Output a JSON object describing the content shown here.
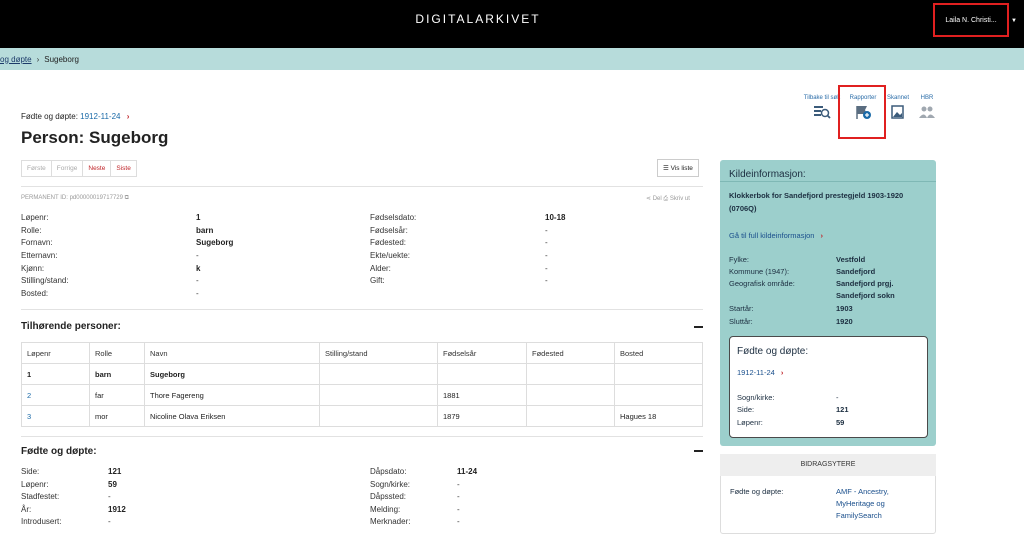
{
  "header": {
    "brand": "DIGITALARKIVET",
    "user": "Laila N. Christi..."
  },
  "breadcrumb": {
    "parent": "og døpte",
    "current": "Sugeborg"
  },
  "subcrumb": {
    "label": "Fødte og døpte:",
    "date": "1912-11-24"
  },
  "title": "Person: Sugeborg",
  "pager": {
    "first": "Første",
    "prev": "Forrige",
    "next": "Neste",
    "last": "Siste"
  },
  "vis_liste": "Vis liste",
  "permanent_id": "PERMANENT ID: pd00000019717729",
  "share": {
    "del": "Del",
    "print": "Skriv ut"
  },
  "person": {
    "left": [
      {
        "k": "Løpenr:",
        "v": "1"
      },
      {
        "k": "Rolle:",
        "v": "barn"
      },
      {
        "k": "Fornavn:",
        "v": "Sugeborg"
      },
      {
        "k": "Etternavn:",
        "v": "-"
      },
      {
        "k": "Kjønn:",
        "v": "k"
      },
      {
        "k": "Stilling/stand:",
        "v": "-"
      },
      {
        "k": "Bosted:",
        "v": "-"
      }
    ],
    "right": [
      {
        "k": "Fødselsdato:",
        "v": "10-18"
      },
      {
        "k": "Fødselsår:",
        "v": "-"
      },
      {
        "k": "Fødested:",
        "v": "-"
      },
      {
        "k": "Ekte/uekte:",
        "v": "-"
      },
      {
        "k": "Alder:",
        "v": "-"
      },
      {
        "k": "Gift:",
        "v": "-"
      }
    ]
  },
  "related": {
    "title": "Tilhørende personer:",
    "headers": [
      "Løpenr",
      "Rolle",
      "Navn",
      "Stilling/stand",
      "Fødselsår",
      "Fødested",
      "Bosted"
    ],
    "rows": [
      [
        "1",
        "barn",
        "Sugeborg",
        "",
        "",
        "",
        ""
      ],
      [
        "2",
        "far",
        "Thore Fagereng",
        "",
        "1881",
        "",
        ""
      ],
      [
        "3",
        "mor",
        "Nicoline Olava Eriksen",
        "",
        "1879",
        "",
        "Hagues 18"
      ]
    ]
  },
  "fodte": {
    "title": "Fødte og døpte:",
    "left": [
      {
        "k": "Side:",
        "v": "121"
      },
      {
        "k": "Løpenr:",
        "v": "59"
      },
      {
        "k": "Stadfestet:",
        "v": "-"
      },
      {
        "k": "År:",
        "v": "1912"
      },
      {
        "k": "Introdusert:",
        "v": "-"
      }
    ],
    "right": [
      {
        "k": "Dåpsdato:",
        "v": "11-24"
      },
      {
        "k": "Sogn/kirke:",
        "v": "-"
      },
      {
        "k": "Dåpssted:",
        "v": "-"
      },
      {
        "k": "Melding:",
        "v": "-"
      },
      {
        "k": "Merknader:",
        "v": "-"
      }
    ]
  },
  "toolbar": {
    "back": "Tilbake til søk",
    "reports": "Rapporter",
    "scanned": "Skannet",
    "hbr": "HBR"
  },
  "kilde": {
    "title": "Kildeinformasjon:",
    "source": "Klokkerbok for Sandefjord prestegjeld 1903-1920 (0706Q)",
    "link": "Gå til full kildeinformasjon",
    "rows": [
      {
        "k": "Fylke:",
        "v": "Vestfold"
      },
      {
        "k": "Kommune (1947):",
        "v": "Sandefjord"
      },
      {
        "k": "Geografisk område:",
        "v": "Sandefjord prgj."
      },
      {
        "k": "",
        "v": "Sandefjord sokn"
      },
      {
        "k": "Startår:",
        "v": "1903"
      },
      {
        "k": "Sluttår:",
        "v": "1920"
      }
    ],
    "inner": {
      "title": "Fødte og døpte:",
      "date": "1912-11-24",
      "rows": [
        {
          "k": "Sogn/kirke:",
          "v": "-"
        },
        {
          "k": "Side:",
          "v": "121"
        },
        {
          "k": "Løpenr:",
          "v": "59"
        }
      ]
    }
  },
  "bidrag": {
    "title": "BIDRAGSYTERE",
    "label": "Fødte og døpte:",
    "value_lines": [
      "AMF - Ancestry,",
      "MyHeritage og",
      "FamilySearch"
    ]
  },
  "colors": {
    "accent_red": "#c0252a",
    "link_blue": "#1a6aa8",
    "panel_teal": "#9ccfcc",
    "crumb_bg": "#b7dcdb"
  }
}
